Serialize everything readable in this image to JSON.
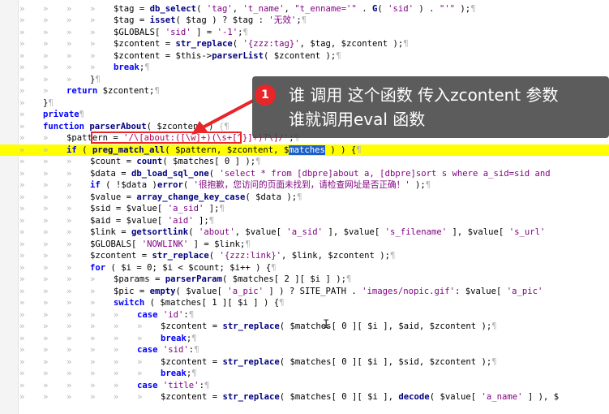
{
  "annotation": {
    "badge_number": "1",
    "line1": "谁 调用 这个函数 传入zcontent 参数",
    "line2": "谁就调用eval 函数",
    "accent_color": "#e8262a"
  },
  "code": {
    "lines": [
      {
        "indent": 4,
        "parts": [
          [
            "var",
            "$tag"
          ],
          [
            "op",
            " = "
          ],
          [
            "fn",
            "db_select"
          ],
          [
            "op",
            "( "
          ],
          [
            "str",
            "'tag'"
          ],
          [
            "op",
            ", "
          ],
          [
            "str",
            "'t_name'"
          ],
          [
            "op",
            ", "
          ],
          [
            "str",
            "\"t_enname='\""
          ],
          [
            "op",
            " . "
          ],
          [
            "fn",
            "G"
          ],
          [
            "op",
            "( "
          ],
          [
            "str",
            "'sid'"
          ],
          [
            "op",
            " ) . "
          ],
          [
            "str",
            "\"'\""
          ],
          [
            "op",
            " );"
          ],
          [
            "pil",
            "¶"
          ]
        ]
      },
      {
        "indent": 4,
        "parts": [
          [
            "var",
            "$tag"
          ],
          [
            "op",
            " = "
          ],
          [
            "fn",
            "isset"
          ],
          [
            "op",
            "( $tag ) ? $tag : "
          ],
          [
            "str",
            "'无效'"
          ],
          [
            "op",
            ";"
          ],
          [
            "pil",
            "¶"
          ]
        ]
      },
      {
        "indent": 4,
        "parts": [
          [
            "var",
            "$GLOBALS"
          ],
          [
            "op",
            "[ "
          ],
          [
            "str",
            "'sid'"
          ],
          [
            "op",
            " ] = "
          ],
          [
            "str",
            "'-1'"
          ],
          [
            "op",
            ";"
          ],
          [
            "pil",
            "¶"
          ]
        ]
      },
      {
        "indent": 4,
        "parts": [
          [
            "var",
            "$zcontent"
          ],
          [
            "op",
            " = "
          ],
          [
            "fn",
            "str_replace"
          ],
          [
            "op",
            "( "
          ],
          [
            "str",
            "'{zzz:tag}'"
          ],
          [
            "op",
            ", $tag, $zcontent );"
          ],
          [
            "pil",
            "¶"
          ]
        ]
      },
      {
        "indent": 4,
        "parts": [
          [
            "var",
            "$zcontent"
          ],
          [
            "op",
            " = $this->"
          ],
          [
            "fn",
            "parserList"
          ],
          [
            "op",
            "( $zcontent );"
          ],
          [
            "pil",
            "¶"
          ]
        ]
      },
      {
        "indent": 4,
        "parts": [
          [
            "kw",
            "break"
          ],
          [
            "op",
            ";"
          ],
          [
            "pil",
            "¶"
          ]
        ]
      },
      {
        "indent": 3,
        "parts": [
          [
            "op",
            "}"
          ],
          [
            "pil",
            "¶"
          ]
        ]
      },
      {
        "indent": 2,
        "parts": [
          [
            "kw",
            "return"
          ],
          [
            "op",
            " $zcontent;"
          ],
          [
            "pil",
            "¶"
          ]
        ]
      },
      {
        "indent": 1,
        "parts": [
          [
            "op",
            "}"
          ],
          [
            "pil",
            "¶"
          ]
        ]
      },
      {
        "indent": 1,
        "parts": [
          [
            "kw",
            "private"
          ],
          [
            "pil",
            "¶"
          ]
        ]
      },
      {
        "indent": 1,
        "parts": [
          [
            "kw",
            "function"
          ],
          [
            "op",
            " "
          ],
          [
            "fn",
            "parserAbout"
          ],
          [
            "op",
            "( $zcontent ) "
          ],
          [
            "pil",
            "{¶"
          ]
        ]
      },
      {
        "indent": 2,
        "parts": [
          [
            "var",
            "$pattern"
          ],
          [
            "op",
            " = "
          ],
          [
            "re",
            "'/\\[about:([\\w]+)(\\s+[^}]+)?\\]/'"
          ],
          [
            "op",
            ";"
          ],
          [
            "pil",
            "¶"
          ]
        ]
      },
      {
        "indent": 2,
        "hl": true,
        "parts": [
          [
            "kw",
            "if"
          ],
          [
            "op",
            " ( "
          ],
          [
            "fn",
            "preg_match_all"
          ],
          [
            "op",
            "( $pattern, $zcontent, $"
          ],
          [
            "sel",
            "matches"
          ],
          [
            "op",
            " ) ) {"
          ],
          [
            "pil",
            "¶"
          ]
        ]
      },
      {
        "indent": 3,
        "parts": [
          [
            "var",
            "$count"
          ],
          [
            "op",
            " = "
          ],
          [
            "fn",
            "count"
          ],
          [
            "op",
            "( $matches[ 0 ] );"
          ],
          [
            "pil",
            "¶"
          ]
        ]
      },
      {
        "indent": 3,
        "parts": [
          [
            "var",
            "$data"
          ],
          [
            "op",
            " = "
          ],
          [
            "fn",
            "db_load_sql_one"
          ],
          [
            "op",
            "( "
          ],
          [
            "str",
            "'select * from [dbpre]about a, [dbpre]sort s where a_sid=sid and"
          ]
        ]
      },
      {
        "indent": 3,
        "parts": [
          [
            "kw",
            "if"
          ],
          [
            "op",
            " ( !$data )"
          ],
          [
            "fn",
            "error"
          ],
          [
            "op",
            "( "
          ],
          [
            "str",
            "'很抱歉，您访问的页面未找到，请检查网址是否正确！'"
          ],
          [
            "op",
            " );"
          ],
          [
            "pil",
            "¶"
          ]
        ]
      },
      {
        "indent": 3,
        "parts": [
          [
            "var",
            "$value"
          ],
          [
            "op",
            " = "
          ],
          [
            "fn",
            "array_change_key_case"
          ],
          [
            "op",
            "( $data );"
          ],
          [
            "pil",
            "¶"
          ]
        ]
      },
      {
        "indent": 3,
        "parts": [
          [
            "var",
            "$sid"
          ],
          [
            "op",
            " = $value[ "
          ],
          [
            "str",
            "'a_sid'"
          ],
          [
            "op",
            " ];"
          ],
          [
            "pil",
            "¶"
          ]
        ]
      },
      {
        "indent": 3,
        "parts": [
          [
            "var",
            "$aid"
          ],
          [
            "op",
            " = $value[ "
          ],
          [
            "str",
            "'aid'"
          ],
          [
            "op",
            " ];"
          ],
          [
            "pil",
            "¶"
          ]
        ]
      },
      {
        "indent": 3,
        "parts": [
          [
            "var",
            "$link"
          ],
          [
            "op",
            " = "
          ],
          [
            "fn",
            "getsortlink"
          ],
          [
            "op",
            "( "
          ],
          [
            "str",
            "'about'"
          ],
          [
            "op",
            ", $value[ "
          ],
          [
            "str",
            "'a_sid'"
          ],
          [
            "op",
            " ], $value[ "
          ],
          [
            "str",
            "'s_filename'"
          ],
          [
            "op",
            " ], $value[ "
          ],
          [
            "str",
            "'s_url'"
          ]
        ]
      },
      {
        "indent": 3,
        "parts": [
          [
            "var",
            "$GLOBALS"
          ],
          [
            "op",
            "[ "
          ],
          [
            "str",
            "'NOWLINK'"
          ],
          [
            "op",
            " ] = $link;"
          ],
          [
            "pil",
            "¶"
          ]
        ]
      },
      {
        "indent": 3,
        "parts": [
          [
            "var",
            "$zcontent"
          ],
          [
            "op",
            " = "
          ],
          [
            "fn",
            "str_replace"
          ],
          [
            "op",
            "( "
          ],
          [
            "str",
            "'{zzz:link}'"
          ],
          [
            "op",
            ", $link, $zcontent );"
          ],
          [
            "pil",
            "¶"
          ]
        ]
      },
      {
        "indent": 3,
        "parts": [
          [
            "kw",
            "for"
          ],
          [
            "op",
            " ( $i = 0; $i < $count; $i++ ) {"
          ],
          [
            "pil",
            "¶"
          ]
        ]
      },
      {
        "indent": 4,
        "parts": [
          [
            "var",
            "$params"
          ],
          [
            "op",
            " = "
          ],
          [
            "fn",
            "parserParam"
          ],
          [
            "op",
            "( $matches[ 2 ][ $i ] );"
          ],
          [
            "pil",
            "¶"
          ]
        ]
      },
      {
        "indent": 4,
        "parts": [
          [
            "var",
            "$pic"
          ],
          [
            "op",
            " = "
          ],
          [
            "fn",
            "empty"
          ],
          [
            "op",
            "( $value[ "
          ],
          [
            "str",
            "'a_pic'"
          ],
          [
            "op",
            " ] ) ? SITE_PATH . "
          ],
          [
            "str",
            "'images/nopic.gif'"
          ],
          [
            "op",
            ": $value[ "
          ],
          [
            "str",
            "'a_pic'"
          ]
        ]
      },
      {
        "indent": 4,
        "parts": [
          [
            "kw",
            "switch"
          ],
          [
            "op",
            " ( $matches[ 1 ][ $i ] ) {"
          ],
          [
            "pil",
            "¶"
          ]
        ]
      },
      {
        "indent": 5,
        "parts": [
          [
            "kw",
            "case"
          ],
          [
            "op",
            " "
          ],
          [
            "str",
            "'id'"
          ],
          [
            "op",
            ":"
          ],
          [
            "pil",
            "¶"
          ]
        ]
      },
      {
        "indent": 6,
        "parts": [
          [
            "var",
            "$zcontent"
          ],
          [
            "op",
            " = "
          ],
          [
            "fn",
            "str_replace"
          ],
          [
            "op",
            "( $matches[ 0 ][ $i ], $aid, $zcontent );"
          ],
          [
            "pil",
            "¶"
          ]
        ]
      },
      {
        "indent": 6,
        "parts": [
          [
            "kw",
            "break"
          ],
          [
            "op",
            ";"
          ],
          [
            "pil",
            "¶"
          ]
        ]
      },
      {
        "indent": 5,
        "parts": [
          [
            "kw",
            "case"
          ],
          [
            "op",
            " "
          ],
          [
            "str",
            "'sid'"
          ],
          [
            "op",
            ":"
          ],
          [
            "pil",
            "¶"
          ]
        ]
      },
      {
        "indent": 6,
        "parts": [
          [
            "var",
            "$zcontent"
          ],
          [
            "op",
            " = "
          ],
          [
            "fn",
            "str_replace"
          ],
          [
            "op",
            "( $matches[ 0 ][ $i ], $sid, $zcontent );"
          ],
          [
            "pil",
            "¶"
          ]
        ]
      },
      {
        "indent": 6,
        "parts": [
          [
            "kw",
            "break"
          ],
          [
            "op",
            ";"
          ],
          [
            "pil",
            "¶"
          ]
        ]
      },
      {
        "indent": 5,
        "parts": [
          [
            "kw",
            "case"
          ],
          [
            "op",
            " "
          ],
          [
            "str",
            "'title'"
          ],
          [
            "op",
            ":"
          ],
          [
            "pil",
            "¶"
          ]
        ]
      },
      {
        "indent": 6,
        "parts": [
          [
            "var",
            "$zcontent"
          ],
          [
            "op",
            " = "
          ],
          [
            "fn",
            "str_replace"
          ],
          [
            "op",
            "( $matches[ 0 ][ $i ], "
          ],
          [
            "fn",
            "decode"
          ],
          [
            "op",
            "( $value[ "
          ],
          [
            "str",
            "'a_name'"
          ],
          [
            "op",
            " ] ), $"
          ]
        ]
      }
    ]
  }
}
